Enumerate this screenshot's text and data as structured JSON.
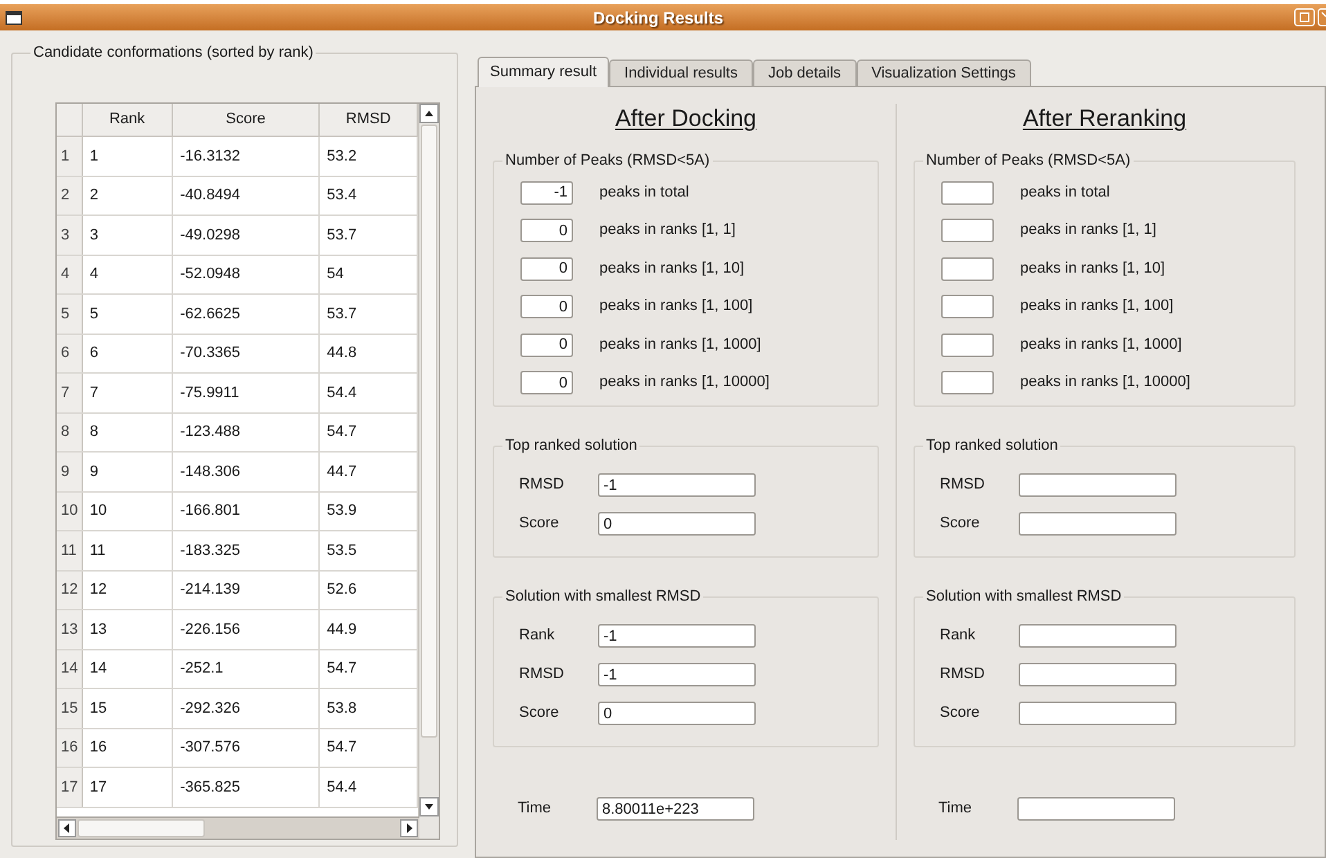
{
  "window": {
    "title": "Docking Results"
  },
  "candidates": {
    "title": "Candidate conformations (sorted by rank)",
    "columns": [
      "Rank",
      "Score",
      "RMSD"
    ],
    "rows": [
      {
        "header": "1",
        "cells": [
          "1",
          "-16.3132",
          "53.2"
        ]
      },
      {
        "header": "2",
        "cells": [
          "2",
          "-40.8494",
          "53.4"
        ]
      },
      {
        "header": "3",
        "cells": [
          "3",
          "-49.0298",
          "53.7"
        ]
      },
      {
        "header": "4",
        "cells": [
          "4",
          "-52.0948",
          "54"
        ]
      },
      {
        "header": "5",
        "cells": [
          "5",
          "-62.6625",
          "53.7"
        ]
      },
      {
        "header": "6",
        "cells": [
          "6",
          "-70.3365",
          "44.8"
        ]
      },
      {
        "header": "7",
        "cells": [
          "7",
          "-75.9911",
          "54.4"
        ]
      },
      {
        "header": "8",
        "cells": [
          "8",
          "-123.488",
          "54.7"
        ]
      },
      {
        "header": "9",
        "cells": [
          "9",
          "-148.306",
          "44.7"
        ]
      },
      {
        "header": "10",
        "cells": [
          "10",
          "-166.801",
          "53.9"
        ]
      },
      {
        "header": "11",
        "cells": [
          "11",
          "-183.325",
          "53.5"
        ]
      },
      {
        "header": "12",
        "cells": [
          "12",
          "-214.139",
          "52.6"
        ]
      },
      {
        "header": "13",
        "cells": [
          "13",
          "-226.156",
          "44.9"
        ]
      },
      {
        "header": "14",
        "cells": [
          "14",
          "-252.1",
          "54.7"
        ]
      },
      {
        "header": "15",
        "cells": [
          "15",
          "-292.326",
          "53.8"
        ]
      },
      {
        "header": "16",
        "cells": [
          "16",
          "-307.576",
          "54.7"
        ]
      },
      {
        "header": "17",
        "cells": [
          "17",
          "-365.825",
          "54.4"
        ]
      }
    ]
  },
  "tabs": [
    {
      "label": "Summary result",
      "selected": true
    },
    {
      "label": "Individual results",
      "selected": false
    },
    {
      "label": "Job details",
      "selected": false
    },
    {
      "label": "Visualization Settings",
      "selected": false
    }
  ],
  "summary": [
    {
      "heading": "After Docking",
      "peaks": {
        "title": "Number of Peaks (RMSD<5A)",
        "rows": [
          {
            "value": "-1",
            "label": "peaks in total"
          },
          {
            "value": "0",
            "label": "peaks in ranks [1, 1]"
          },
          {
            "value": "0",
            "label": "peaks in ranks [1, 10]"
          },
          {
            "value": "0",
            "label": "peaks in ranks [1, 100]"
          },
          {
            "value": "0",
            "label": "peaks in ranks [1, 1000]"
          },
          {
            "value": "0",
            "label": "peaks in ranks [1, 10000]"
          }
        ]
      },
      "top_ranked": {
        "title": "Top ranked solution",
        "fields": [
          {
            "label": "RMSD",
            "value": "-1"
          },
          {
            "label": "Score",
            "value": "0"
          }
        ]
      },
      "smallest_rmsd": {
        "title": "Solution with smallest RMSD",
        "fields": [
          {
            "label": "Rank",
            "value": "-1"
          },
          {
            "label": "RMSD",
            "value": "-1"
          },
          {
            "label": "Score",
            "value": "0"
          }
        ]
      },
      "time": {
        "label": "Time",
        "value": "8.80011e+223"
      }
    },
    {
      "heading": "After Reranking",
      "peaks": {
        "title": "Number of Peaks (RMSD<5A)",
        "rows": [
          {
            "label": "peaks in total"
          },
          {
            "label": "peaks in ranks [1, 1]"
          },
          {
            "label": "peaks in ranks [1, 10]"
          },
          {
            "label": "peaks in ranks [1, 100]"
          },
          {
            "label": "peaks in ranks [1, 1000]"
          },
          {
            "label": "peaks in ranks [1, 10000]"
          }
        ]
      },
      "top_ranked": {
        "title": "Top ranked solution",
        "fields": [
          {
            "label": "RMSD"
          },
          {
            "label": "Score"
          }
        ]
      },
      "smallest_rmsd": {
        "title": "Solution with smallest RMSD",
        "fields": [
          {
            "label": "Rank"
          },
          {
            "label": "RMSD"
          },
          {
            "label": "Score"
          }
        ]
      },
      "time": {
        "label": "Time"
      }
    }
  ]
}
